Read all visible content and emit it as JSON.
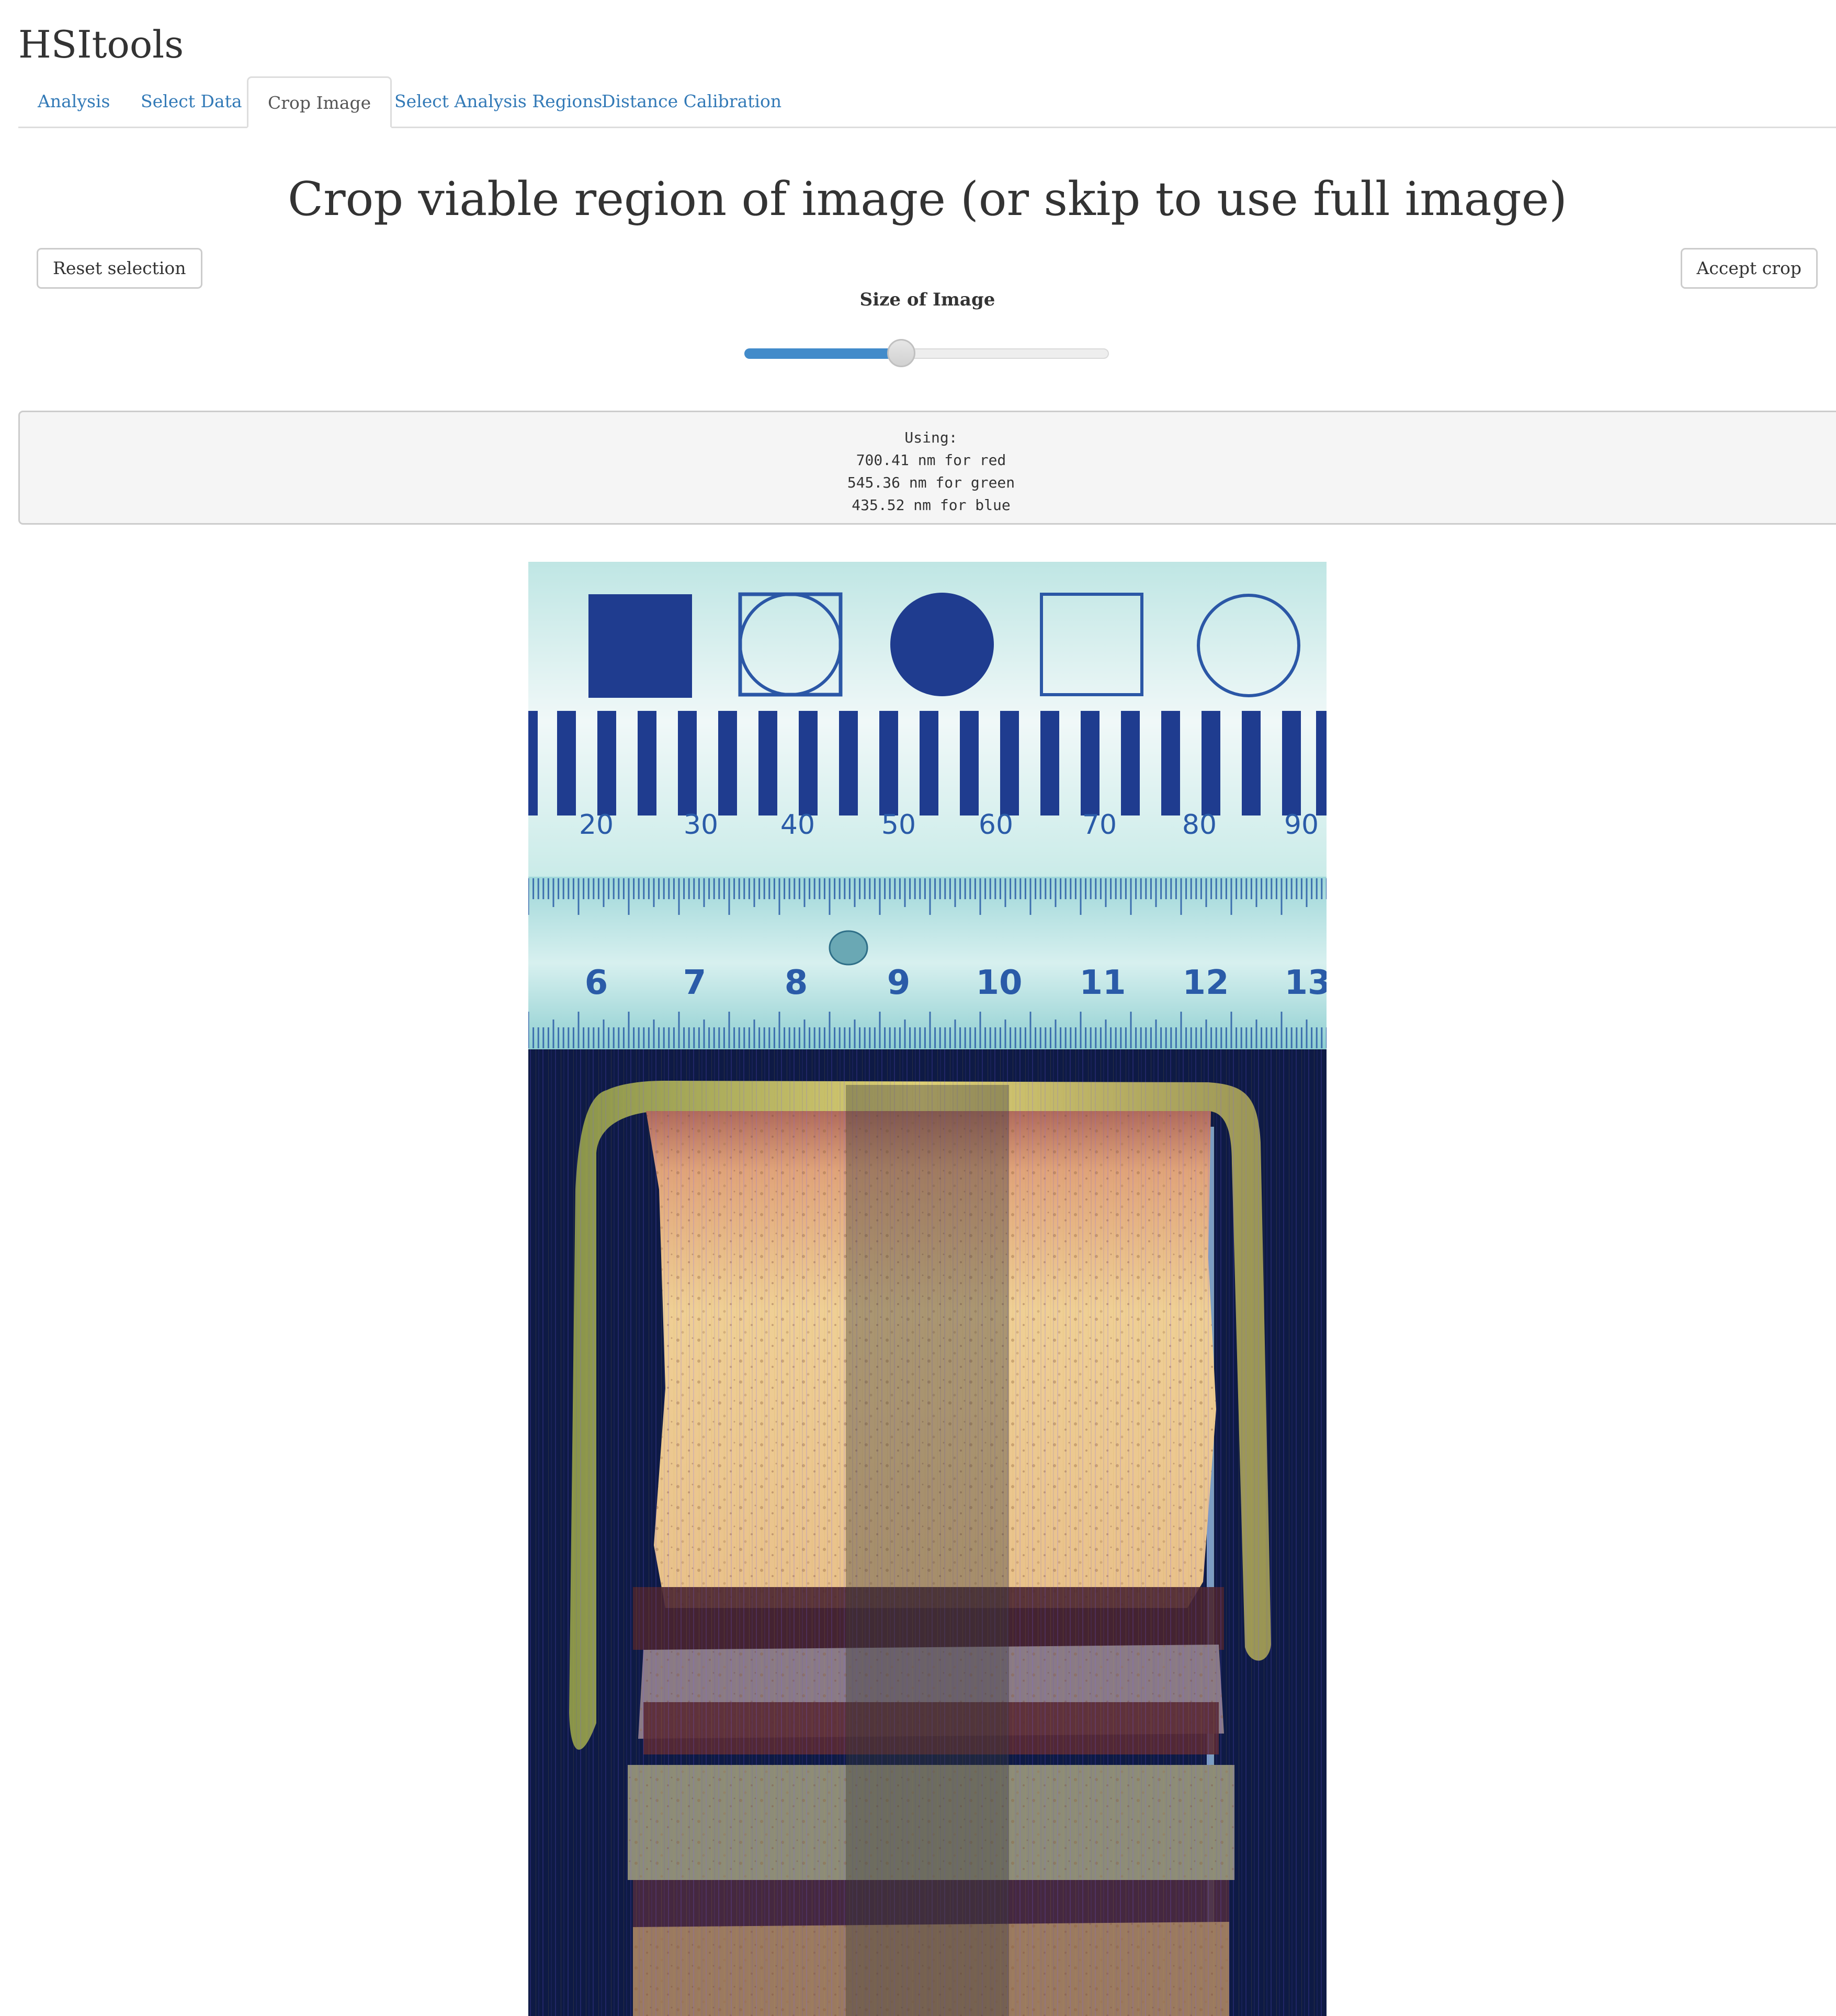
{
  "app": {
    "title": "HSItools"
  },
  "tabs": [
    {
      "label": "Analysis",
      "active": false
    },
    {
      "label": "Select Data",
      "active": false
    },
    {
      "label": "Crop Image",
      "active": true
    },
    {
      "label": "Select Analysis Regions",
      "active": false
    },
    {
      "label": "Distance Calibration",
      "active": false
    }
  ],
  "page": {
    "heading": "Crop viable region of image (or skip to use full image)",
    "reset_button": "Reset selection",
    "accept_button": "Accept crop"
  },
  "slider": {
    "label": "Size of Image",
    "value_fraction": 0.43
  },
  "info": {
    "heading": "Using:",
    "lines": [
      "700.41 nm for red",
      "545.36 nm for green",
      "435.52 nm for blue"
    ]
  },
  "image": {
    "scale_top_labels": [
      "20",
      "30",
      "40",
      "50",
      "60",
      "70",
      "80",
      "90"
    ],
    "ruler_labels": [
      "6",
      "7",
      "8",
      "9",
      "10",
      "11",
      "12",
      "13"
    ]
  },
  "colors": {
    "accent": "#337ab7",
    "slider_fill": "#428bca"
  }
}
